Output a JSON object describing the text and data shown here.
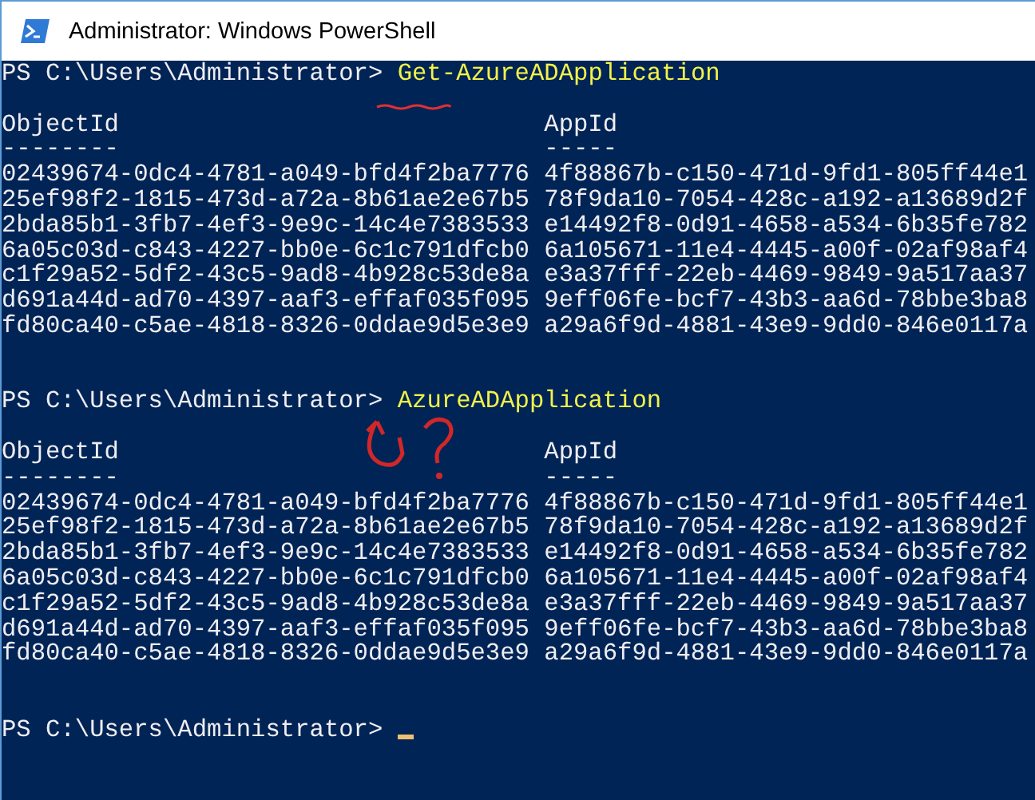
{
  "window": {
    "title": "Administrator: Windows PowerShell"
  },
  "blocks": [
    {
      "prompt": "PS C:\\Users\\Administrator>",
      "command": "Get-AzureADApplication",
      "columns": [
        {
          "label": "ObjectId",
          "rule": "--------"
        },
        {
          "label": "AppId",
          "rule": "-----"
        }
      ],
      "rows": [
        [
          "02439674-0dc4-4781-a049-bfd4f2ba7776",
          "4f88867b-c150-471d-9fd1-805ff44e1"
        ],
        [
          "25ef98f2-1815-473d-a72a-8b61ae2e67b5",
          "78f9da10-7054-428c-a192-a13689d2f"
        ],
        [
          "2bda85b1-3fb7-4ef3-9e9c-14c4e7383533",
          "e14492f8-0d91-4658-a534-6b35fe782"
        ],
        [
          "6a05c03d-c843-4227-bb0e-6c1c791dfcb0",
          "6a105671-11e4-4445-a00f-02af98af4"
        ],
        [
          "c1f29a52-5df2-43c5-9ad8-4b928c53de8a",
          "e3a37fff-22eb-4469-9849-9a517aa37"
        ],
        [
          "d691a44d-ad70-4397-aaf3-effaf035f095",
          "9eff06fe-bcf7-43b3-aa6d-78bbe3ba8"
        ],
        [
          "fd80ca40-c5ae-4818-8326-0ddae9d5e3e9",
          "a29a6f9d-4881-43e9-9dd0-846e0117a"
        ]
      ]
    },
    {
      "prompt": "PS C:\\Users\\Administrator>",
      "command": "AzureADApplication",
      "columns": [
        {
          "label": "ObjectId",
          "rule": "--------"
        },
        {
          "label": "AppId",
          "rule": "-----"
        }
      ],
      "rows": [
        [
          "02439674-0dc4-4781-a049-bfd4f2ba7776",
          "4f88867b-c150-471d-9fd1-805ff44e1"
        ],
        [
          "25ef98f2-1815-473d-a72a-8b61ae2e67b5",
          "78f9da10-7054-428c-a192-a13689d2f"
        ],
        [
          "2bda85b1-3fb7-4ef3-9e9c-14c4e7383533",
          "e14492f8-0d91-4658-a534-6b35fe782"
        ],
        [
          "6a05c03d-c843-4227-bb0e-6c1c791dfcb0",
          "6a105671-11e4-4445-a00f-02af98af4"
        ],
        [
          "c1f29a52-5df2-43c5-9ad8-4b928c53de8a",
          "e3a37fff-22eb-4469-9849-9a517aa37"
        ],
        [
          "d691a44d-ad70-4397-aaf3-effaf035f095",
          "9eff06fe-bcf7-43b3-aa6d-78bbe3ba8"
        ],
        [
          "fd80ca40-c5ae-4818-8326-0ddae9d5e3e9",
          "a29a6f9d-4881-43e9-9dd0-846e0117a"
        ]
      ]
    }
  ],
  "final_prompt": "PS C:\\Users\\Administrator>"
}
